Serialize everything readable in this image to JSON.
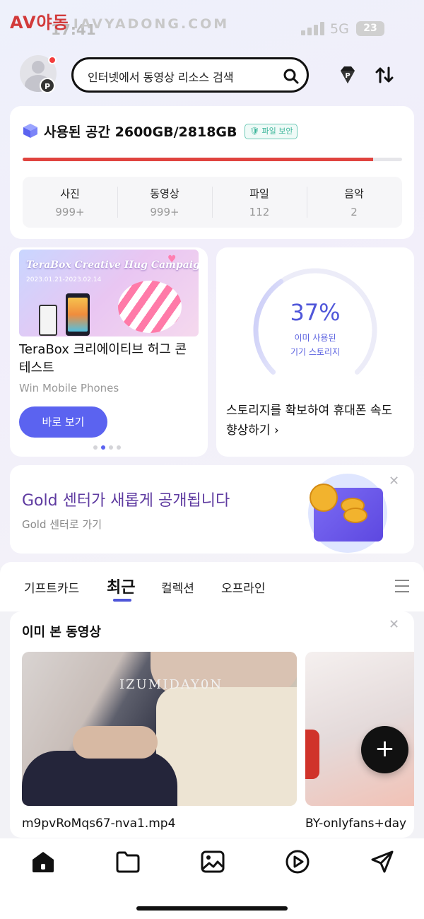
{
  "status": {
    "watermark_brand": "AV야동",
    "watermark_url": "IAVYADONG.COM",
    "time": "17:41",
    "network": "5G",
    "battery": "23"
  },
  "header": {
    "search_placeholder": "인터넷에서 동영상 리소스 검색",
    "icons": [
      "avatar",
      "search-icon",
      "diamond-icon",
      "transfer-icon"
    ],
    "avatar_badge": "P",
    "diamond_badge": "P"
  },
  "storage": {
    "used_label": "사용된 공간 2600GB/2818GB",
    "secure_label": "파일 보안",
    "used_fraction": 0.923,
    "bar_color": "#e0443f",
    "stats": [
      {
        "label": "사진",
        "value": "999+"
      },
      {
        "label": "동영상",
        "value": "999+"
      },
      {
        "label": "파일",
        "value": "112"
      },
      {
        "label": "음악",
        "value": "2"
      }
    ]
  },
  "promo": {
    "image_title": "TeraBox Creative Hug Campaign",
    "image_dates": "2023.01.21-2023.02.14",
    "title": "TeraBox 크리에이티브 허그 콘테스트",
    "subtitle": "Win Mobile Phones",
    "button": "바로 보기",
    "carousel_active_index": 1,
    "carousel_count": 4
  },
  "device_storage": {
    "percent": "37%",
    "percent_value": 0.37,
    "line1": "이미 사용된",
    "line2": "기기 스토리지",
    "cta": "스토리지를 확보하여 휴대폰 속도 향상하기 ›"
  },
  "gold": {
    "title": "Gold 센터가 새롭게 공개됩니다",
    "subtitle": "Gold 센터로 가기",
    "title_color": "#5e3aa0"
  },
  "tabs": {
    "items": [
      "기프트카드",
      "최근",
      "컬렉션",
      "오프라인"
    ],
    "active": "최근"
  },
  "recent": {
    "title": "이미 본 동영상",
    "videos": [
      {
        "filename": "m9pvRoMqs67-nva1.mp4",
        "watermark": "IZUMIDAY0N"
      },
      {
        "filename": "BY-onlyfans+day"
      }
    ]
  },
  "fab": {
    "label": "+"
  },
  "bottom_nav": [
    "home-icon",
    "folder-icon",
    "image-icon",
    "play-icon",
    "send-icon"
  ],
  "colors": {
    "accent": "#5b63f0",
    "fab": "#111111"
  }
}
